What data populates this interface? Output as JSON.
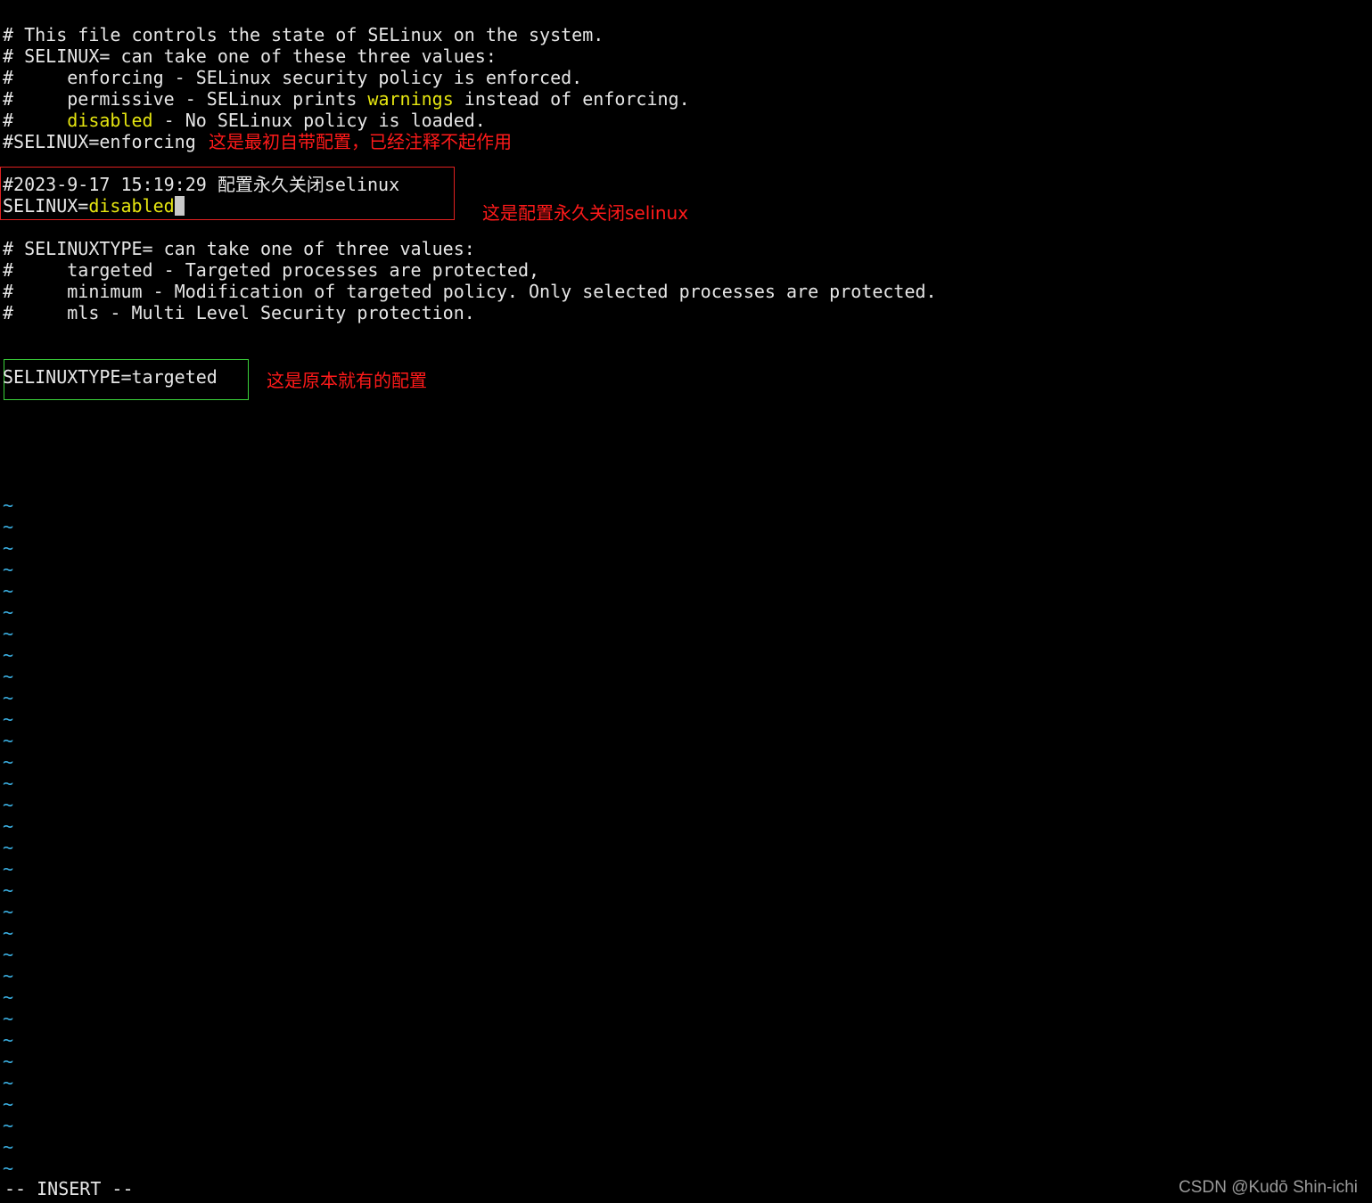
{
  "editor": {
    "lines": {
      "l1": "# This file controls the state of SELinux on the system.",
      "l2": "# SELINUX= can take one of these three values:",
      "l3": "#     enforcing - SELinux security policy is enforced.",
      "l4_a": "#     permissive - SELinux prints ",
      "l4_b": "warnings",
      "l4_c": " instead of enforcing.",
      "l5_a": "#     ",
      "l5_b": "disabled",
      "l5_c": " - No SELinux policy is loaded.",
      "l6": "#SELINUX=enforcing",
      "l7": "#2023-9-17 15:19:29 配置永久关闭selinux",
      "l8_a": "SELINUX=",
      "l8_b": "disabled",
      "l9": "# SELINUXTYPE= can take one of three values:",
      "l10": "#     targeted - Targeted processes are protected,",
      "l11": "#     minimum - Modification of targeted policy. Only selected processes are protected.",
      "l12": "#     mls - Multi Level Security protection.",
      "l13": "SELINUXTYPE=targeted"
    },
    "tilde_char": "~",
    "mode": "-- INSERT --"
  },
  "annotations": {
    "note_original": "这是最初自带配置，已经注释不起作用",
    "note_disabled": "这是配置永久关闭selinux",
    "note_type": "这是原本就有的配置"
  },
  "watermark": "CSDN @Kudō Shin-ichi",
  "colors": {
    "background": "#000000",
    "text": "#e6e6e6",
    "keyword_yellow": "#e5e510",
    "annotation_red": "#ff1a1a",
    "tilde_blue": "#3aaee0",
    "box_red": "#e02020",
    "box_green": "#3ad23a"
  }
}
